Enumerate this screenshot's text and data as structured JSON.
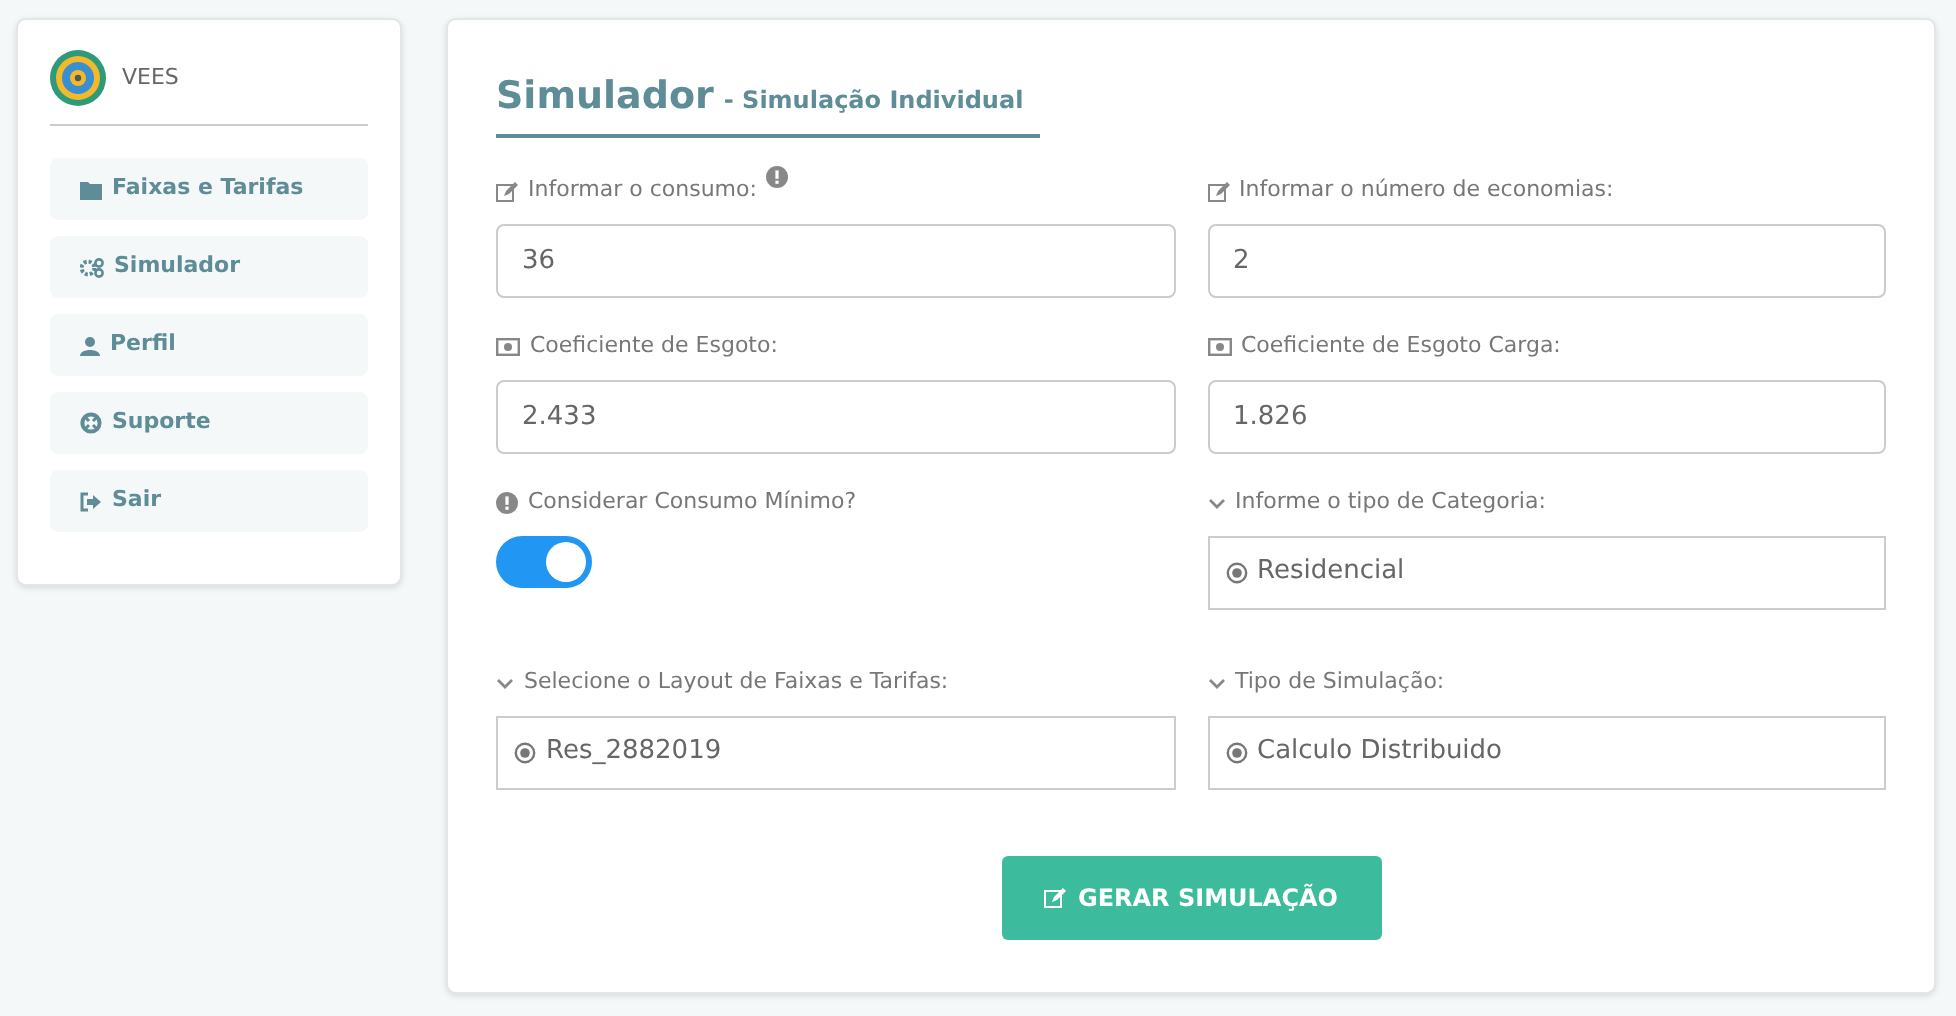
{
  "sidebar": {
    "brand": "VEES",
    "items": [
      {
        "label": "Faixas e Tarifas"
      },
      {
        "label": "Simulador"
      },
      {
        "label": "Perfil"
      },
      {
        "label": "Suporte"
      },
      {
        "label": "Sair"
      }
    ]
  },
  "heading": {
    "title": "Simulador",
    "subtitle": "- Simulação Individual"
  },
  "fields": [
    {
      "kind": "input",
      "label": "Informar o consumo:",
      "value": "36"
    },
    {
      "kind": "input",
      "label": "Informar o número de economias:",
      "value": "2"
    },
    {
      "kind": "input",
      "label": "Coeficiente de Esgoto:",
      "value": "2.433"
    },
    {
      "kind": "input",
      "label": "Coeficiente de Esgoto Carga:",
      "value": "1.826"
    },
    {
      "kind": "toggle",
      "label": "Considerar Consumo Mínimo?",
      "on": true
    },
    {
      "kind": "select",
      "label": "Informe o tipo de Categoria:",
      "value": "Residencial"
    },
    {
      "kind": "select",
      "label": "Selecione o Layout de Faixas e Tarifas:",
      "value": "Res_2882019"
    },
    {
      "kind": "select",
      "label": "Tipo de Simulação:",
      "value": "Calculo Distribuido"
    }
  ],
  "submit": {
    "label": "GERAR SIMULAÇÃO"
  }
}
